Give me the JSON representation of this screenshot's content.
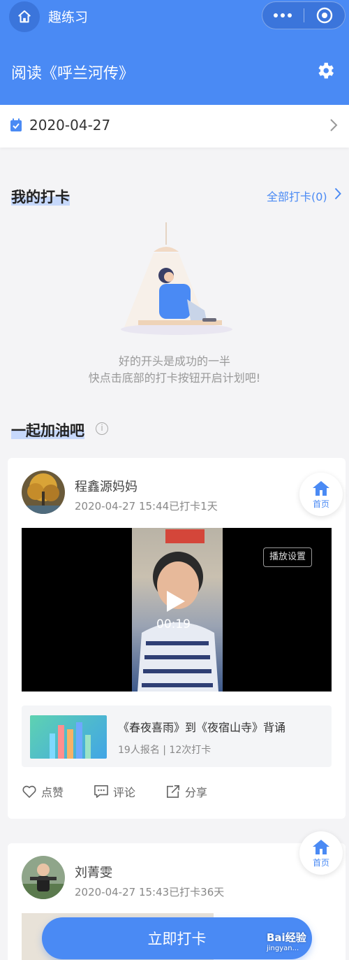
{
  "colors": {
    "primary": "#4a8af4",
    "primary_dark": "#3b75db",
    "background": "#f4f4f6"
  },
  "nav": {
    "app_name": "趣练习",
    "home_icon": "home-icon",
    "more_icon": "more-dots-icon",
    "close_icon": "target-circle-icon"
  },
  "header": {
    "title": "阅读《呼兰河传》",
    "settings_icon": "gear-icon"
  },
  "date_bar": {
    "date": "2020-04-27",
    "calendar_icon": "calendar-check-icon"
  },
  "my_checkin": {
    "title": "我的打卡",
    "all_link": "全部打卡(0)",
    "empty_line1": "好的开头是成功的一半",
    "empty_line2": "快点击底部的打卡按钮开启计划吧!"
  },
  "together": {
    "title": "一起加油吧"
  },
  "posts": [
    {
      "user": "程鑫源妈妈",
      "meta": "2020-04-27 15:44已打卡1天",
      "video": {
        "duration": "00:19",
        "setting_label": "播放设置"
      },
      "course": {
        "title": "《春夜喜雨》到《夜宿山寺》背诵",
        "stats": "19人报名 | 12次打卡"
      },
      "actions": {
        "like": "点赞",
        "comment": "评论",
        "share": "分享"
      }
    },
    {
      "user": "刘菁雯",
      "meta": "2020-04-27 15:43已打卡36天"
    }
  ],
  "floating": {
    "home_label": "首页"
  },
  "cta": {
    "label": "立即打卡"
  },
  "watermark": {
    "brand": "Bai经验",
    "domain": "jingyan..."
  }
}
